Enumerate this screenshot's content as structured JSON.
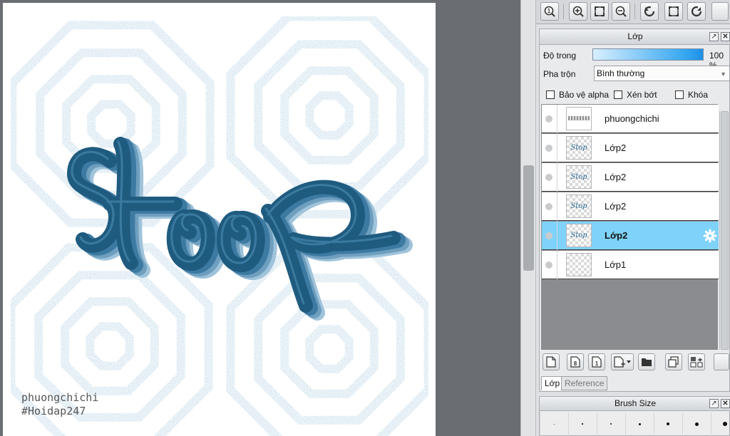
{
  "canvas": {
    "artwork_text": "Stop",
    "watermark_line1": "phuongchichi",
    "watermark_line2": "#Hoidap247"
  },
  "navigator_toolbar": {
    "buttons": [
      "zoom-fit-icon",
      "zoom-in-icon",
      "fit-screen-icon",
      "zoom-out-icon",
      "rotate-left-icon",
      "actual-size-icon",
      "rotate-right-icon"
    ]
  },
  "layer_panel": {
    "title": "Lớp",
    "opacity_label": "Độ trong",
    "opacity_value": "100 %",
    "opacity_percent": 100,
    "blend_label": "Pha trộn",
    "blend_value": "Bình thường",
    "checkboxes": [
      {
        "label": "Bảo vệ alpha",
        "checked": false
      },
      {
        "label": "Xén bớt",
        "checked": false
      },
      {
        "label": "Khóa",
        "checked": false
      }
    ],
    "layers": [
      {
        "name": "phuongchichi",
        "thumb": "",
        "selected": false
      },
      {
        "name": "Lớp2",
        "thumb": "Stop",
        "selected": false
      },
      {
        "name": "Lớp2",
        "thumb": "Stop",
        "selected": false
      },
      {
        "name": "Lớp2",
        "thumb": "Stop",
        "selected": false
      },
      {
        "name": "Lớp2",
        "thumb": "Stop",
        "selected": true
      },
      {
        "name": "Lớp1",
        "thumb": "",
        "selected": false
      }
    ],
    "tabs": [
      {
        "label": "Lớp",
        "active": true
      },
      {
        "label": "Reference",
        "active": false
      }
    ]
  },
  "brush_panel": {
    "title": "Brush Size"
  },
  "colors": {
    "selected_layer": "#7fd3fb",
    "lettering": "#1f5b7f",
    "pattern": "#9fc3da"
  }
}
